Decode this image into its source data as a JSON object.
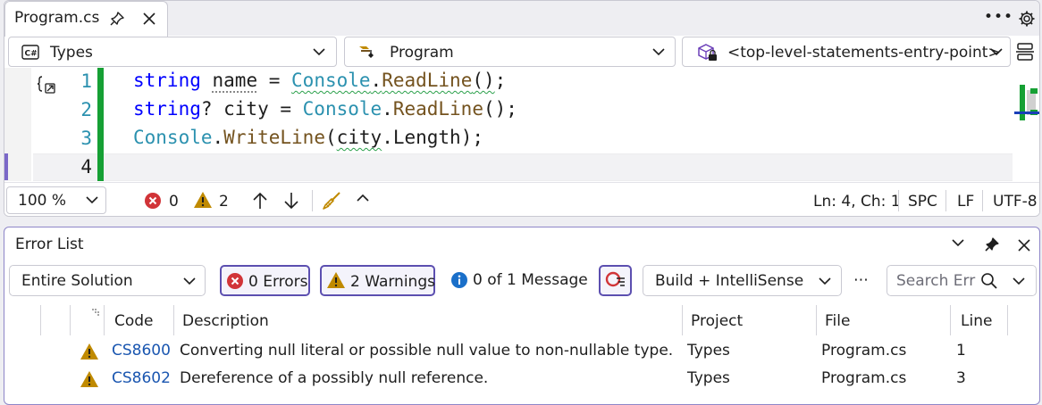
{
  "editor": {
    "tab_title": "Program.cs",
    "nav": {
      "project": "Types",
      "type": "Program",
      "member": "<top-level-statements-entry-point>"
    },
    "line_numbers": [
      "1",
      "2",
      "3",
      "4"
    ],
    "code_lines": [
      [
        {
          "t": "string",
          "c": "kw"
        },
        {
          "t": " ",
          "c": "pl"
        },
        {
          "t": "name",
          "c": "pl dots"
        },
        {
          "t": " = ",
          "c": "pl"
        },
        {
          "t": "Console",
          "c": "ty squig"
        },
        {
          "t": ".",
          "c": "pl squig"
        },
        {
          "t": "ReadLine",
          "c": "me squig"
        },
        {
          "t": "()",
          "c": "pl squig"
        },
        {
          "t": ";",
          "c": "pl"
        }
      ],
      [
        {
          "t": "string",
          "c": "kw"
        },
        {
          "t": "? city = ",
          "c": "pl"
        },
        {
          "t": "Console",
          "c": "ty"
        },
        {
          "t": ".",
          "c": "pl"
        },
        {
          "t": "ReadLine",
          "c": "me"
        },
        {
          "t": "();",
          "c": "pl"
        }
      ],
      [
        {
          "t": "Console",
          "c": "ty"
        },
        {
          "t": ".",
          "c": "pl"
        },
        {
          "t": "WriteLine",
          "c": "me"
        },
        {
          "t": "(",
          "c": "pl"
        },
        {
          "t": "city",
          "c": "pl squig"
        },
        {
          "t": ".Length);",
          "c": "pl"
        }
      ],
      []
    ],
    "status": {
      "zoom": "100 %",
      "error_count": "0",
      "warning_count": "2",
      "position": "Ln: 4, Ch: 1",
      "whitespace": "SPC",
      "line_ending": "LF",
      "encoding": "UTF-8"
    }
  },
  "error_list": {
    "title": "Error List",
    "scope": "Entire Solution",
    "errors_label": "0 Errors",
    "warnings_label": "2 Warnings",
    "messages_label": "0 of 1 Message",
    "build_filter": "Build + IntelliSense",
    "more": "⋯",
    "search_placeholder": "Search Err",
    "columns": [
      "Code",
      "Description",
      "Project",
      "File",
      "Line"
    ],
    "rows": [
      {
        "code": "CS8600",
        "description": "Converting null literal or possible null value to non-nullable type.",
        "project": "Types",
        "file": "Program.cs",
        "line": "1"
      },
      {
        "code": "CS8602",
        "description": "Dereference of a possibly null reference.",
        "project": "Types",
        "file": "Program.cs",
        "line": "3"
      }
    ]
  },
  "colors": {
    "keyword": "#0000ff",
    "type": "#2b91af",
    "method": "#74531f",
    "error_red": "#d13438",
    "warning_amber": "#c08a00",
    "info_blue": "#1a6fc9",
    "accent": "#5c4fb0",
    "change_bar": "#16a034"
  }
}
